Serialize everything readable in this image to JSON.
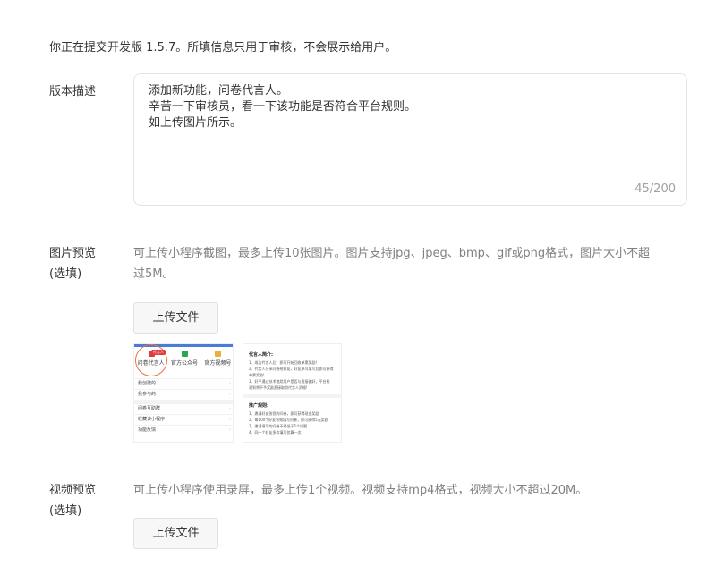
{
  "notice": "你正在提交开发版 1.5.7。所填信息只用于审核，不会展示给用户。",
  "description": {
    "label": "版本描述",
    "text": "添加新功能，问卷代言人。\n辛苦一下审核员，看一下该功能是否符合平台规则。\n如上传图片所示。",
    "counter": "45/200"
  },
  "image_preview": {
    "label_line1": "图片预览",
    "label_line2": "(选填)",
    "tip_line1": "可上传小程序截图，最多上传10张图片。图片支持jpg、jpeg、bmp、gif或png格式，图片大小不超",
    "tip_line2": "过5M。",
    "upload_label": "上传文件",
    "thumb1": {
      "badge": "代言人",
      "cells": [
        "问卷代言人",
        "官方公众号",
        "官方视频号"
      ],
      "rows": [
        "我创建的",
        "我参与的",
        "问卷互助群",
        "收藏该小程序",
        "功能反馈"
      ],
      "colors": {
        "accent": "#e23b3b",
        "green": "#2aa551",
        "yellow": "#e8b13a",
        "circle": "#e8753a",
        "bar": "#4a7bd7"
      }
    },
    "thumb2": {
      "title1": "代言人简介:",
      "lines1": [
        "1、成为代言人后，即可开始回收单票奖励!",
        "2、代言人分享问卷给好友，好友参与填写后即可获得",
        "单票奖励!",
        "3、好平通过技术追踪用户是否与直接偏好，平台检",
        "测到将不予奖励直接取消代言人资格!"
      ],
      "title2": "推广规则:",
      "lines2": [
        "1、邀请好友答您的问卷，即可获得现金奖励",
        "2、每100个好友有效填写问卷，即可获得5元奖励",
        "3、邀请填写的问卷不得低于5个问题",
        "4、同一个好友多次填写仅算一次"
      ]
    }
  },
  "video_preview": {
    "label_line1": "视频预览",
    "label_line2": "(选填)",
    "tip": "可上传小程序使用录屏，最多上传1个视频。视频支持mp4格式，视频大小不超过20M。",
    "upload_label": "上传文件"
  }
}
